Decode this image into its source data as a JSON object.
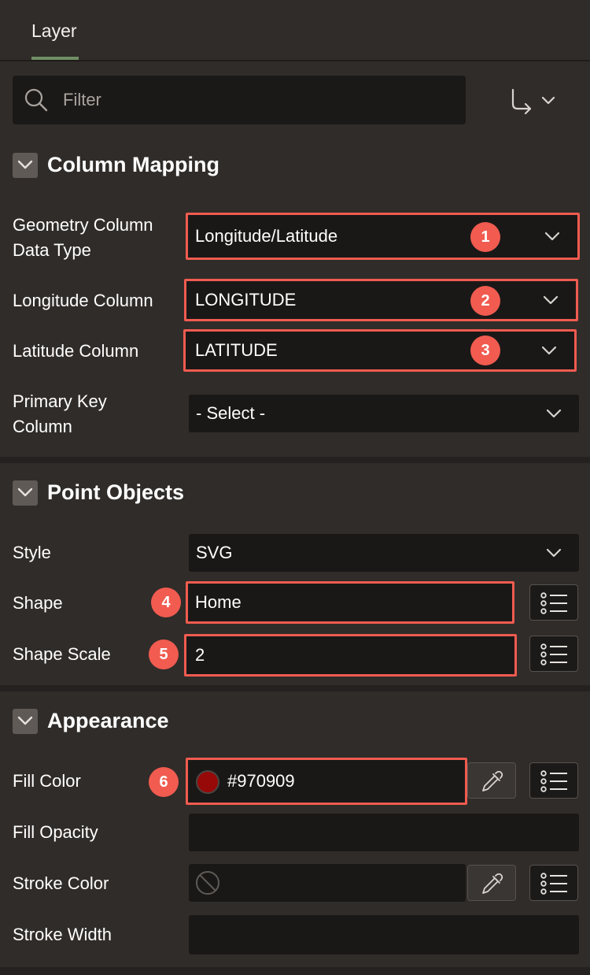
{
  "tabs": [
    {
      "label": "Layer"
    }
  ],
  "filter": {
    "placeholder": "Filter"
  },
  "sections": {
    "column_mapping": {
      "title": "Column Mapping",
      "geometry_label": "Geometry Column Data Type",
      "geometry_value": "Longitude/Latitude",
      "longitude_label": "Longitude Column",
      "longitude_value": "LONGITUDE",
      "latitude_label": "Latitude Column",
      "latitude_value": "LATITUDE",
      "primary_key_label": "Primary Key Column",
      "primary_key_value": "- Select -"
    },
    "point_objects": {
      "title": "Point Objects",
      "style_label": "Style",
      "style_value": "SVG",
      "shape_label": "Shape",
      "shape_value": "Home",
      "scale_label": "Shape Scale",
      "scale_value": "2"
    },
    "appearance": {
      "title": "Appearance",
      "fill_color_label": "Fill Color",
      "fill_color_value": "#970909",
      "fill_opacity_label": "Fill Opacity",
      "stroke_color_label": "Stroke Color",
      "stroke_width_label": "Stroke Width"
    }
  },
  "callouts": [
    "1",
    "2",
    "3",
    "4",
    "5",
    "6"
  ],
  "colors": {
    "background": "#302c29",
    "field": "#1a1817",
    "highlight": "#f15b50",
    "tab_accent": "#6f8f64",
    "fill_swatch": "#970909"
  }
}
